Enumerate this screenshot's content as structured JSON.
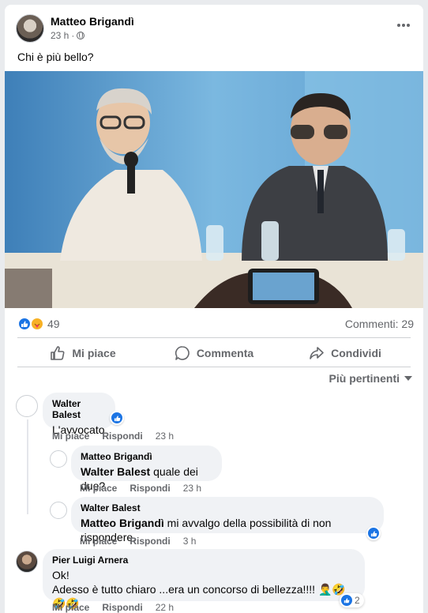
{
  "post": {
    "author": "Matteo Brigandì",
    "time": "23 h",
    "separator": "·",
    "text": "Chi è più bello?",
    "more_icon": "more-horizontal-icon",
    "privacy_icon": "globe-icon"
  },
  "stats": {
    "reaction_count": "49",
    "comments_label": "Commenti: 29",
    "reaction_icons": [
      "like-icon",
      "care-icon"
    ]
  },
  "actions": {
    "like": "Mi piace",
    "comment": "Commenta",
    "share": "Condividi"
  },
  "sort": {
    "label": "Più pertinenti"
  },
  "comments": [
    {
      "author": "Walter Balest",
      "text": "L'avvocato",
      "like": "Mi piace",
      "reply": "Rispondi",
      "time": "23 h"
    },
    {
      "author": "Matteo Brigandì",
      "mention": "Walter Balest",
      "text": " quale dei due?",
      "like": "Mi piace",
      "reply": "Rispondi",
      "time": "23 h"
    },
    {
      "author": "Walter Balest",
      "mention": "Matteo Brigandì",
      "text": " mi avvalgo della possibilità di non rispondere.",
      "like": "Mi piace",
      "reply": "Rispondi",
      "time": "3 h"
    },
    {
      "author": "Pier Luigi Arnera",
      "line1": "Ok!",
      "line2": "Adesso è tutto chiaro ...era un concorso di bellezza!!!! 🤦‍♂️🤣🤣🤣",
      "like": "Mi piace",
      "reply": "Rispondi",
      "time": "22 h",
      "reaction_count": "2"
    }
  ]
}
